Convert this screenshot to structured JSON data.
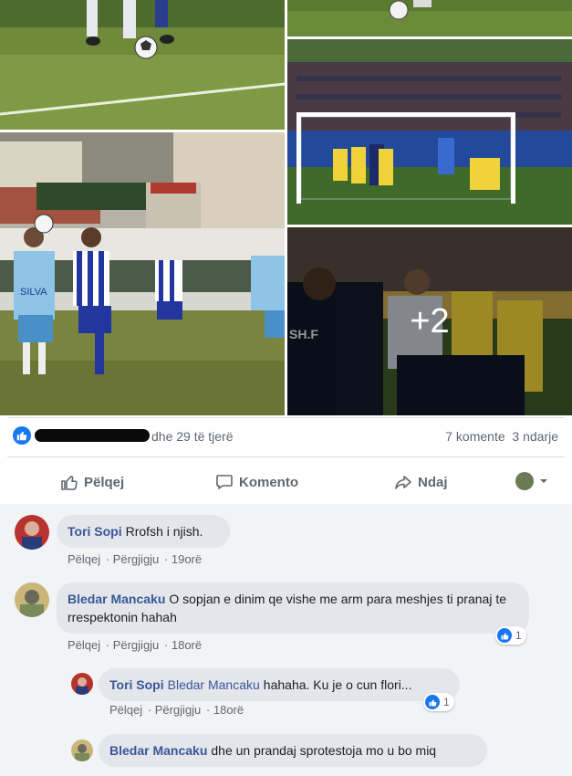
{
  "photos": {
    "more_overlay": "+2",
    "shirt_text": "SH.F",
    "jersey_text": "SILVA"
  },
  "reactions": {
    "text": "dhe 29 të tjerë",
    "comments_count": "7 komente",
    "shares_count": "3 ndarje"
  },
  "actions": {
    "like": "Pëlqej",
    "comment": "Komento",
    "share": "Ndaj"
  },
  "comments": [
    {
      "author": "Tori Sopi",
      "text": "Rrofsh i njish.",
      "like": "Pëlqej",
      "reply": "Përgjigju",
      "time": "19orë"
    },
    {
      "author": "Bledar Mancaku",
      "text": "O sopjan e dinim qe vishe me arm para meshjes ti pranaj te rrespektonin hahah",
      "like": "Pëlqej",
      "reply": "Përgjigju",
      "time": "18orë",
      "reaction_count": "1"
    },
    {
      "author": "Tori Sopi",
      "mention": "Bledar Mancaku",
      "text": "hahaha. Ku je o cun flori...",
      "like": "Pëlqej",
      "reply": "Përgjigju",
      "time": "18orë",
      "reaction_count": "1"
    },
    {
      "author": "Bledar Mancaku",
      "text": "dhe un prandaj sprotestoja mo u bo miq"
    }
  ],
  "colors": {
    "link": "#385898",
    "like_blue": "#1877f2",
    "bubble": "#e4e6eb",
    "muted": "#606770"
  }
}
